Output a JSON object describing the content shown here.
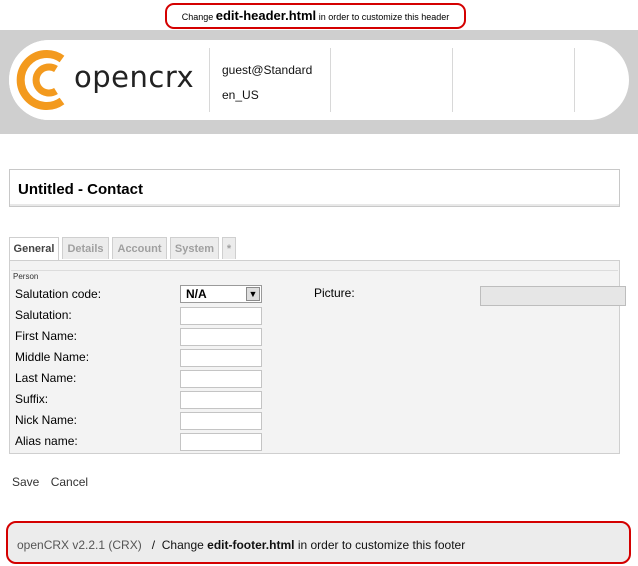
{
  "header_notice": {
    "prefix": "Change",
    "file": "edit-header.html",
    "suffix": "in order to customize this header"
  },
  "banner": {
    "logo_text": "opencrx",
    "user": "guest@Standard",
    "locale": "en_US"
  },
  "page_title": "Untitled - Contact",
  "tabs": [
    {
      "label": "General",
      "active": true
    },
    {
      "label": "Details",
      "active": false
    },
    {
      "label": "Account",
      "active": false
    },
    {
      "label": "System",
      "active": false
    },
    {
      "label": "*",
      "active": false
    }
  ],
  "form": {
    "section": "Person",
    "salutation_code_label": "Salutation code:",
    "salutation_code_value": "N/A",
    "picture_label": "Picture:",
    "fields": [
      {
        "label": "Salutation:",
        "value": ""
      },
      {
        "label": "First Name:",
        "value": ""
      },
      {
        "label": "Middle Name:",
        "value": ""
      },
      {
        "label": "Last Name:",
        "value": ""
      },
      {
        "label": "Suffix:",
        "value": ""
      },
      {
        "label": "Nick Name:",
        "value": ""
      },
      {
        "label": "Alias name:",
        "value": ""
      }
    ]
  },
  "actions": {
    "save": "Save",
    "cancel": "Cancel"
  },
  "footer": {
    "version": "openCRX v2.2.1 (CRX)",
    "separator": "/",
    "prefix": "Change",
    "file": "edit-footer.html",
    "suffix": "in order to customize this footer"
  },
  "colors": {
    "notice_border": "#d40000",
    "logo_orange": "#f39a1e",
    "banner_gray": "#cfcfcf"
  }
}
